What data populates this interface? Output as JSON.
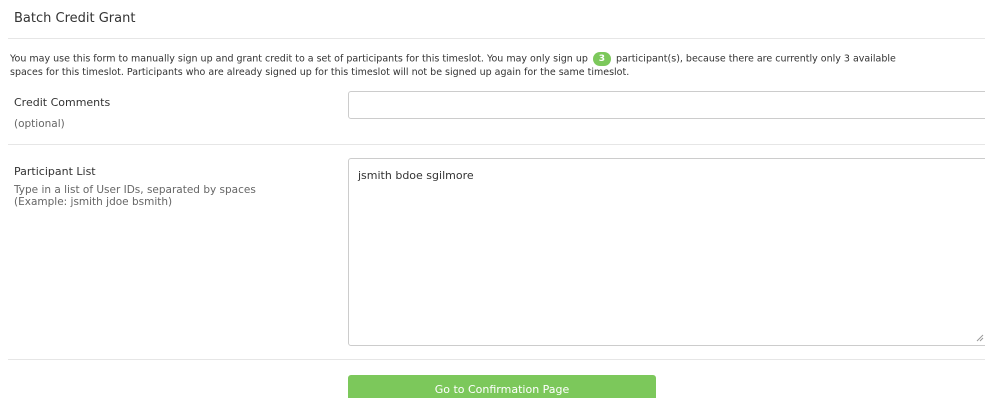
{
  "panel": {
    "title": "Batch Credit Grant"
  },
  "intro": {
    "line1_before": "You may use this form to manually sign up and grant credit to a set of participants for this timeslot. You may only sign up",
    "badge_count": "3",
    "line1_after": "participant(s), because there are currently only 3 available",
    "line2": "spaces for this timeslot. Participants who are already signed up for this timeslot will not be signed up again for the same timeslot."
  },
  "credit_comments": {
    "label": "Credit Comments",
    "hint": "(optional)",
    "value": "",
    "placeholder": ""
  },
  "participant_list": {
    "label": "Participant List",
    "hint_line1": "Type in a list of User IDs, separated by spaces",
    "hint_line2": "(Example: jsmith jdoe bsmith)",
    "value": "jsmith bdoe sgilmore"
  },
  "actions": {
    "confirm_label": "Go to Confirmation Page"
  },
  "colors": {
    "accent": "#7cc85b",
    "divider": "#e6e6e6",
    "border": "#cccccc"
  },
  "icons": {
    "resize": "resize-grip-icon"
  }
}
